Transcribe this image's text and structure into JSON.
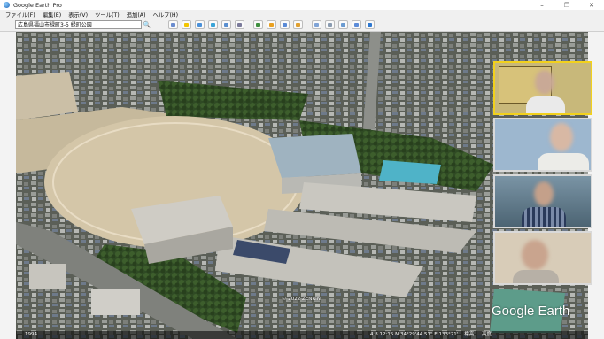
{
  "window": {
    "title": "Google Earth Pro",
    "min_label": "–",
    "max_label": "❐",
    "close_label": "✕"
  },
  "menu": [
    {
      "label": "ファイル(F)"
    },
    {
      "label": "編集(E)"
    },
    {
      "label": "表示(V)"
    },
    {
      "label": "ツール(T)"
    },
    {
      "label": "追加(A)"
    },
    {
      "label": "ヘルプ(H)"
    }
  ],
  "search": {
    "value": "広島県福山市緑町3-5 緑町公園",
    "button_icon": "search-icon"
  },
  "toolbar_icons": [
    {
      "name": "hide-sidebar-icon",
      "color": "#6a8ccf"
    },
    {
      "name": "add-placemark-icon",
      "color": "#f2c500"
    },
    {
      "name": "add-polygon-icon",
      "color": "#4a90d9"
    },
    {
      "name": "add-path-icon",
      "color": "#3aa4d8"
    },
    {
      "name": "add-image-overlay-icon",
      "color": "#5a8fd0"
    },
    {
      "name": "record-tour-icon",
      "color": "#7a7a9a"
    },
    {
      "name": "historical-imagery-icon",
      "color": "#3f8f3f"
    },
    {
      "name": "sunlight-icon",
      "color": "#e9a020"
    },
    {
      "name": "switch-planet-icon",
      "color": "#5a8ad6"
    },
    {
      "name": "ruler-icon",
      "color": "#e0a030"
    },
    {
      "name": "email-icon",
      "color": "#7fa3d6"
    },
    {
      "name": "print-icon",
      "color": "#8a9bb0"
    },
    {
      "name": "save-image-icon",
      "color": "#6b9bd1"
    },
    {
      "name": "view-in-maps-icon",
      "color": "#5b8bd8"
    },
    {
      "name": "globe-icon",
      "color": "#2e78d0"
    }
  ],
  "videos": [
    {
      "label": "participant-1",
      "bg": "#c8b87a",
      "active": true
    },
    {
      "label": "participant-2",
      "bg": "#9db7cf",
      "active": false
    },
    {
      "label": "participant-3",
      "bg": "#6f8a9a",
      "active": false
    },
    {
      "label": "participant-4",
      "bg": "#d8ccb8",
      "active": false
    }
  ],
  "overlay": {
    "logo": "Google Earth",
    "copyright": "© 2022 ZENRIN"
  },
  "status": {
    "left": "1994",
    "right": "4.8 12:15  N 34°29'44.51\" E 133°21'...   標高   ...   高度   ..."
  }
}
